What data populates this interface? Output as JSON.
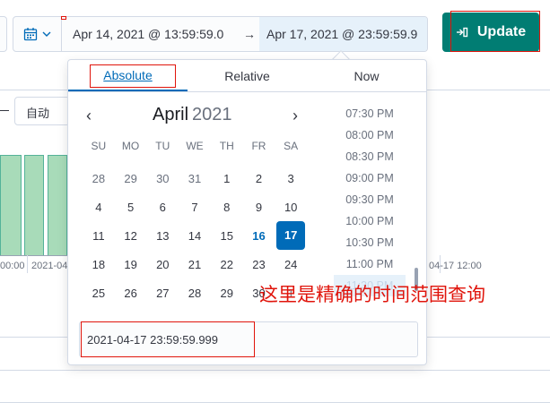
{
  "toolbar": {
    "start_date": "Apr 14, 2021 @ 13:59:59.0",
    "arrow": "→",
    "end_date": "Apr 17, 2021 @ 23:59:59.9",
    "update_label": "Update",
    "quick_select_icon": "calendar-icon"
  },
  "background": {
    "interval_select": "自动",
    "x_labels": [
      "00:00",
      "2021-04",
      "04-17 12:00"
    ]
  },
  "popover": {
    "tabs": [
      {
        "label": "Absolute",
        "active": true
      },
      {
        "label": "Relative",
        "active": false
      },
      {
        "label": "Now",
        "active": false
      }
    ],
    "calendar": {
      "month": "April",
      "year": "2021",
      "weekdays": [
        "SU",
        "MO",
        "TU",
        "WE",
        "TH",
        "FR",
        "SA"
      ],
      "weeks": [
        [
          "28",
          "29",
          "30",
          "31",
          "1",
          "2",
          "3"
        ],
        [
          "4",
          "5",
          "6",
          "7",
          "8",
          "9",
          "10"
        ],
        [
          "11",
          "12",
          "13",
          "14",
          "15",
          "16",
          "17"
        ],
        [
          "18",
          "19",
          "20",
          "21",
          "22",
          "23",
          "24"
        ],
        [
          "25",
          "26",
          "27",
          "28",
          "29",
          "30",
          "1"
        ]
      ],
      "today": "16",
      "selected": "17"
    },
    "times": [
      "07:30 PM",
      "08:00 PM",
      "08:30 PM",
      "09:00 PM",
      "09:30 PM",
      "10:00 PM",
      "10:30 PM",
      "11:00 PM",
      "11:30 PM"
    ],
    "selected_time": "11:30 PM",
    "date_input_value": "2021-04-17 23:59:59.999"
  },
  "annotation": "这里是精确的时间范围查询",
  "colors": {
    "accent": "#006bb8",
    "update": "#017d73",
    "annotation": "#e0140b",
    "bar_fill": "#a8dbb9"
  }
}
